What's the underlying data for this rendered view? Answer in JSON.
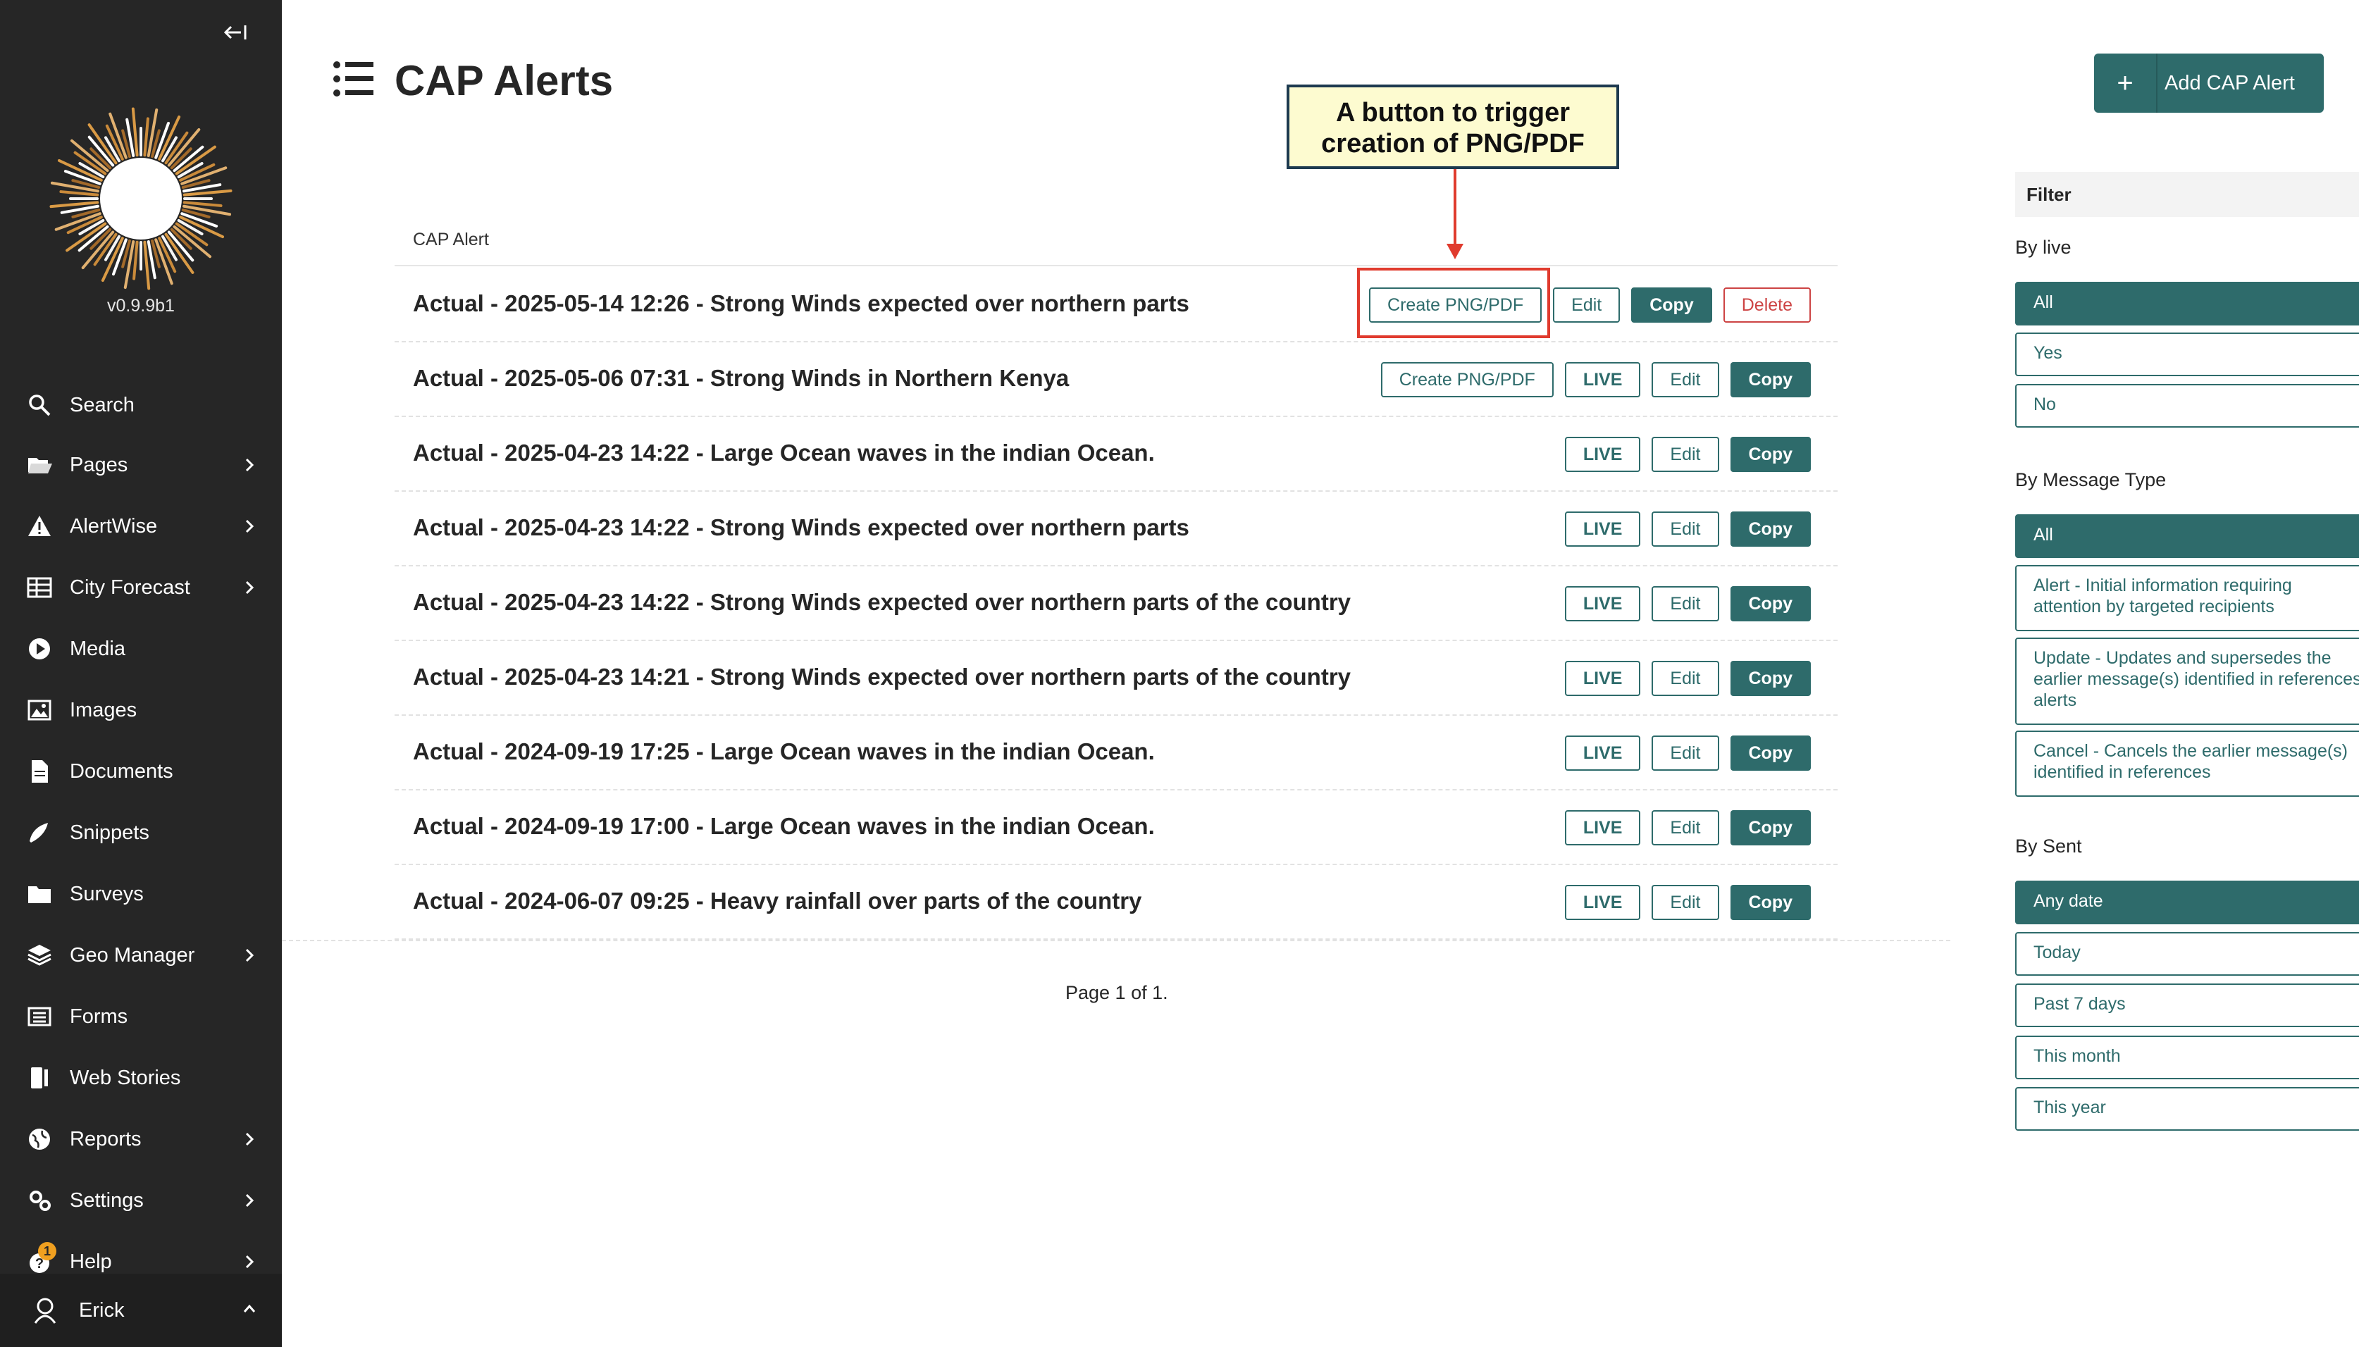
{
  "sidebar": {
    "version": "v0.9.9b1",
    "items": [
      {
        "label": "Search",
        "icon": "search-icon"
      },
      {
        "label": "Pages",
        "icon": "folder-open-icon"
      },
      {
        "label": "AlertWise",
        "icon": "warning-icon"
      },
      {
        "label": "City Forecast",
        "icon": "table-icon"
      },
      {
        "label": "Media",
        "icon": "play-icon"
      },
      {
        "label": "Images",
        "icon": "image-icon"
      },
      {
        "label": "Documents",
        "icon": "document-icon"
      },
      {
        "label": "Snippets",
        "icon": "snippet-icon"
      },
      {
        "label": "Surveys",
        "icon": "folder-icon"
      },
      {
        "label": "Geo Manager",
        "icon": "layers-icon"
      },
      {
        "label": "Forms",
        "icon": "list-icon"
      },
      {
        "label": "Web Stories",
        "icon": "stories-icon"
      },
      {
        "label": "Reports",
        "icon": "globe-icon"
      },
      {
        "label": "Settings",
        "icon": "cogs-icon"
      },
      {
        "label": "Help",
        "icon": "help-icon",
        "badge": "1"
      }
    ],
    "user": "Erick"
  },
  "header": {
    "title": "CAP Alerts",
    "add_button": "Add CAP Alert"
  },
  "callout": {
    "line1": "A button to trigger",
    "line2": "creation of PNG/PDF"
  },
  "table": {
    "column": "CAP Alert",
    "rows": [
      {
        "title": "Actual - 2025-05-14 12:26 - Strong Winds expected over northern parts",
        "buttons": [
          "Create PNG/PDF",
          "Edit",
          "Copy",
          "Delete"
        ]
      },
      {
        "title": "Actual - 2025-05-06 07:31 - Strong Winds in Northern Kenya",
        "buttons": [
          "Create PNG/PDF",
          "LIVE",
          "Edit",
          "Copy"
        ]
      },
      {
        "title": "Actual - 2025-04-23 14:22 - Large Ocean waves in the indian Ocean.",
        "buttons": [
          "LIVE",
          "Edit",
          "Copy"
        ]
      },
      {
        "title": "Actual - 2025-04-23 14:22 - Strong Winds expected over northern parts",
        "buttons": [
          "LIVE",
          "Edit",
          "Copy"
        ]
      },
      {
        "title": "Actual - 2025-04-23 14:22 - Strong Winds expected over northern parts of the country",
        "buttons": [
          "LIVE",
          "Edit",
          "Copy"
        ]
      },
      {
        "title": "Actual - 2025-04-23 14:21 - Strong Winds expected over northern parts of the country",
        "buttons": [
          "LIVE",
          "Edit",
          "Copy"
        ]
      },
      {
        "title": "Actual - 2024-09-19 17:25 - Large Ocean waves in the indian Ocean.",
        "buttons": [
          "LIVE",
          "Edit",
          "Copy"
        ]
      },
      {
        "title": "Actual - 2024-09-19 17:00 - Large Ocean waves in the indian Ocean.",
        "buttons": [
          "LIVE",
          "Edit",
          "Copy"
        ]
      },
      {
        "title": "Actual - 2024-06-07 09:25 - Heavy rainfall over parts of the country",
        "buttons": [
          "LIVE",
          "Edit",
          "Copy"
        ]
      }
    ],
    "pagination": "Page 1 of 1."
  },
  "filter": {
    "title": "Filter",
    "by_live": {
      "label": "By live",
      "options": [
        "All",
        "Yes",
        "No"
      ],
      "selected": "All"
    },
    "by_message_type": {
      "label": "By Message Type",
      "options": [
        "All",
        "Alert - Initial information requiring attention by targeted recipients",
        "Update - Updates and supersedes the earlier message(s) identified in references alerts",
        "Cancel - Cancels the earlier message(s) identified in references"
      ],
      "selected": "All"
    },
    "by_sent": {
      "label": "By Sent",
      "options": [
        "Any date",
        "Today",
        "Past 7 days",
        "This month",
        "This year"
      ],
      "selected": "Any date"
    }
  },
  "colors": {
    "primary": "#2e6b6b",
    "sidebar": "#262626",
    "danger": "#cd4444",
    "callout_border": "#e03b2e",
    "callout_bg": "#fdfbd0"
  }
}
